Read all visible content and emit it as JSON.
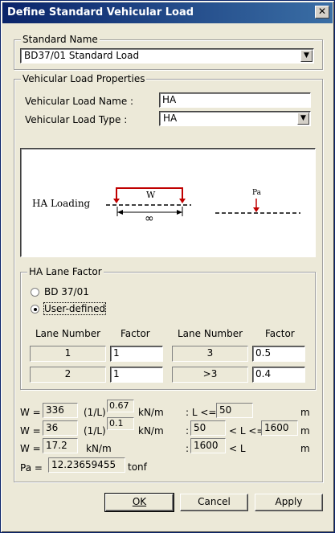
{
  "window": {
    "title": "Define Standard Vehicular Load",
    "close_glyph": "✕"
  },
  "standard": {
    "group_label": "Standard Name",
    "value": "BD37/01 Standard Load"
  },
  "properties": {
    "group_label": "Vehicular Load Properties",
    "name_label": "Vehicular Load Name :",
    "name_value": "HA",
    "type_label": "Vehicular Load Type :",
    "type_value": "HA"
  },
  "diagram": {
    "caption": "HA Loading",
    "w_label": "W",
    "infinity": "∞",
    "pa_label": "Pa"
  },
  "lane_factor": {
    "group_label": "HA Lane Factor",
    "option_bd": "BD 37/01",
    "option_user": "User-defined",
    "selected": "User-defined",
    "headers": [
      "Lane Number",
      "Factor",
      "Lane Number",
      "Factor"
    ],
    "rows": [
      {
        "lane1": "1",
        "factor1": "1",
        "lane2": "3",
        "factor2": "0.5"
      },
      {
        "lane1": "2",
        "factor1": "1",
        "lane2": ">3",
        "factor2": "0.4"
      }
    ]
  },
  "formulas": {
    "w_label": "W =",
    "row1": {
      "coef": "336",
      "mid": "(1/L)",
      "exp": "0.67",
      "unit": "kN/m",
      "cond": ": L <=",
      "limit": "50",
      "m": "m"
    },
    "row2": {
      "coef": "36",
      "mid": "(1/L)",
      "exp": "0.1",
      "unit": "kN/m",
      "colon": ":",
      "low": "50",
      "cond": "< L <=",
      "high": "1600",
      "m": "m"
    },
    "row3": {
      "coef": "17.2",
      "unit": "kN/m",
      "colon": ":",
      "low": "1600",
      "cond": "< L",
      "m": "m"
    },
    "pa_label": "Pa =",
    "pa_value": "12.23659455",
    "pa_unit": "tonf"
  },
  "buttons": {
    "ok": "OK",
    "cancel": "Cancel",
    "apply": "Apply"
  }
}
